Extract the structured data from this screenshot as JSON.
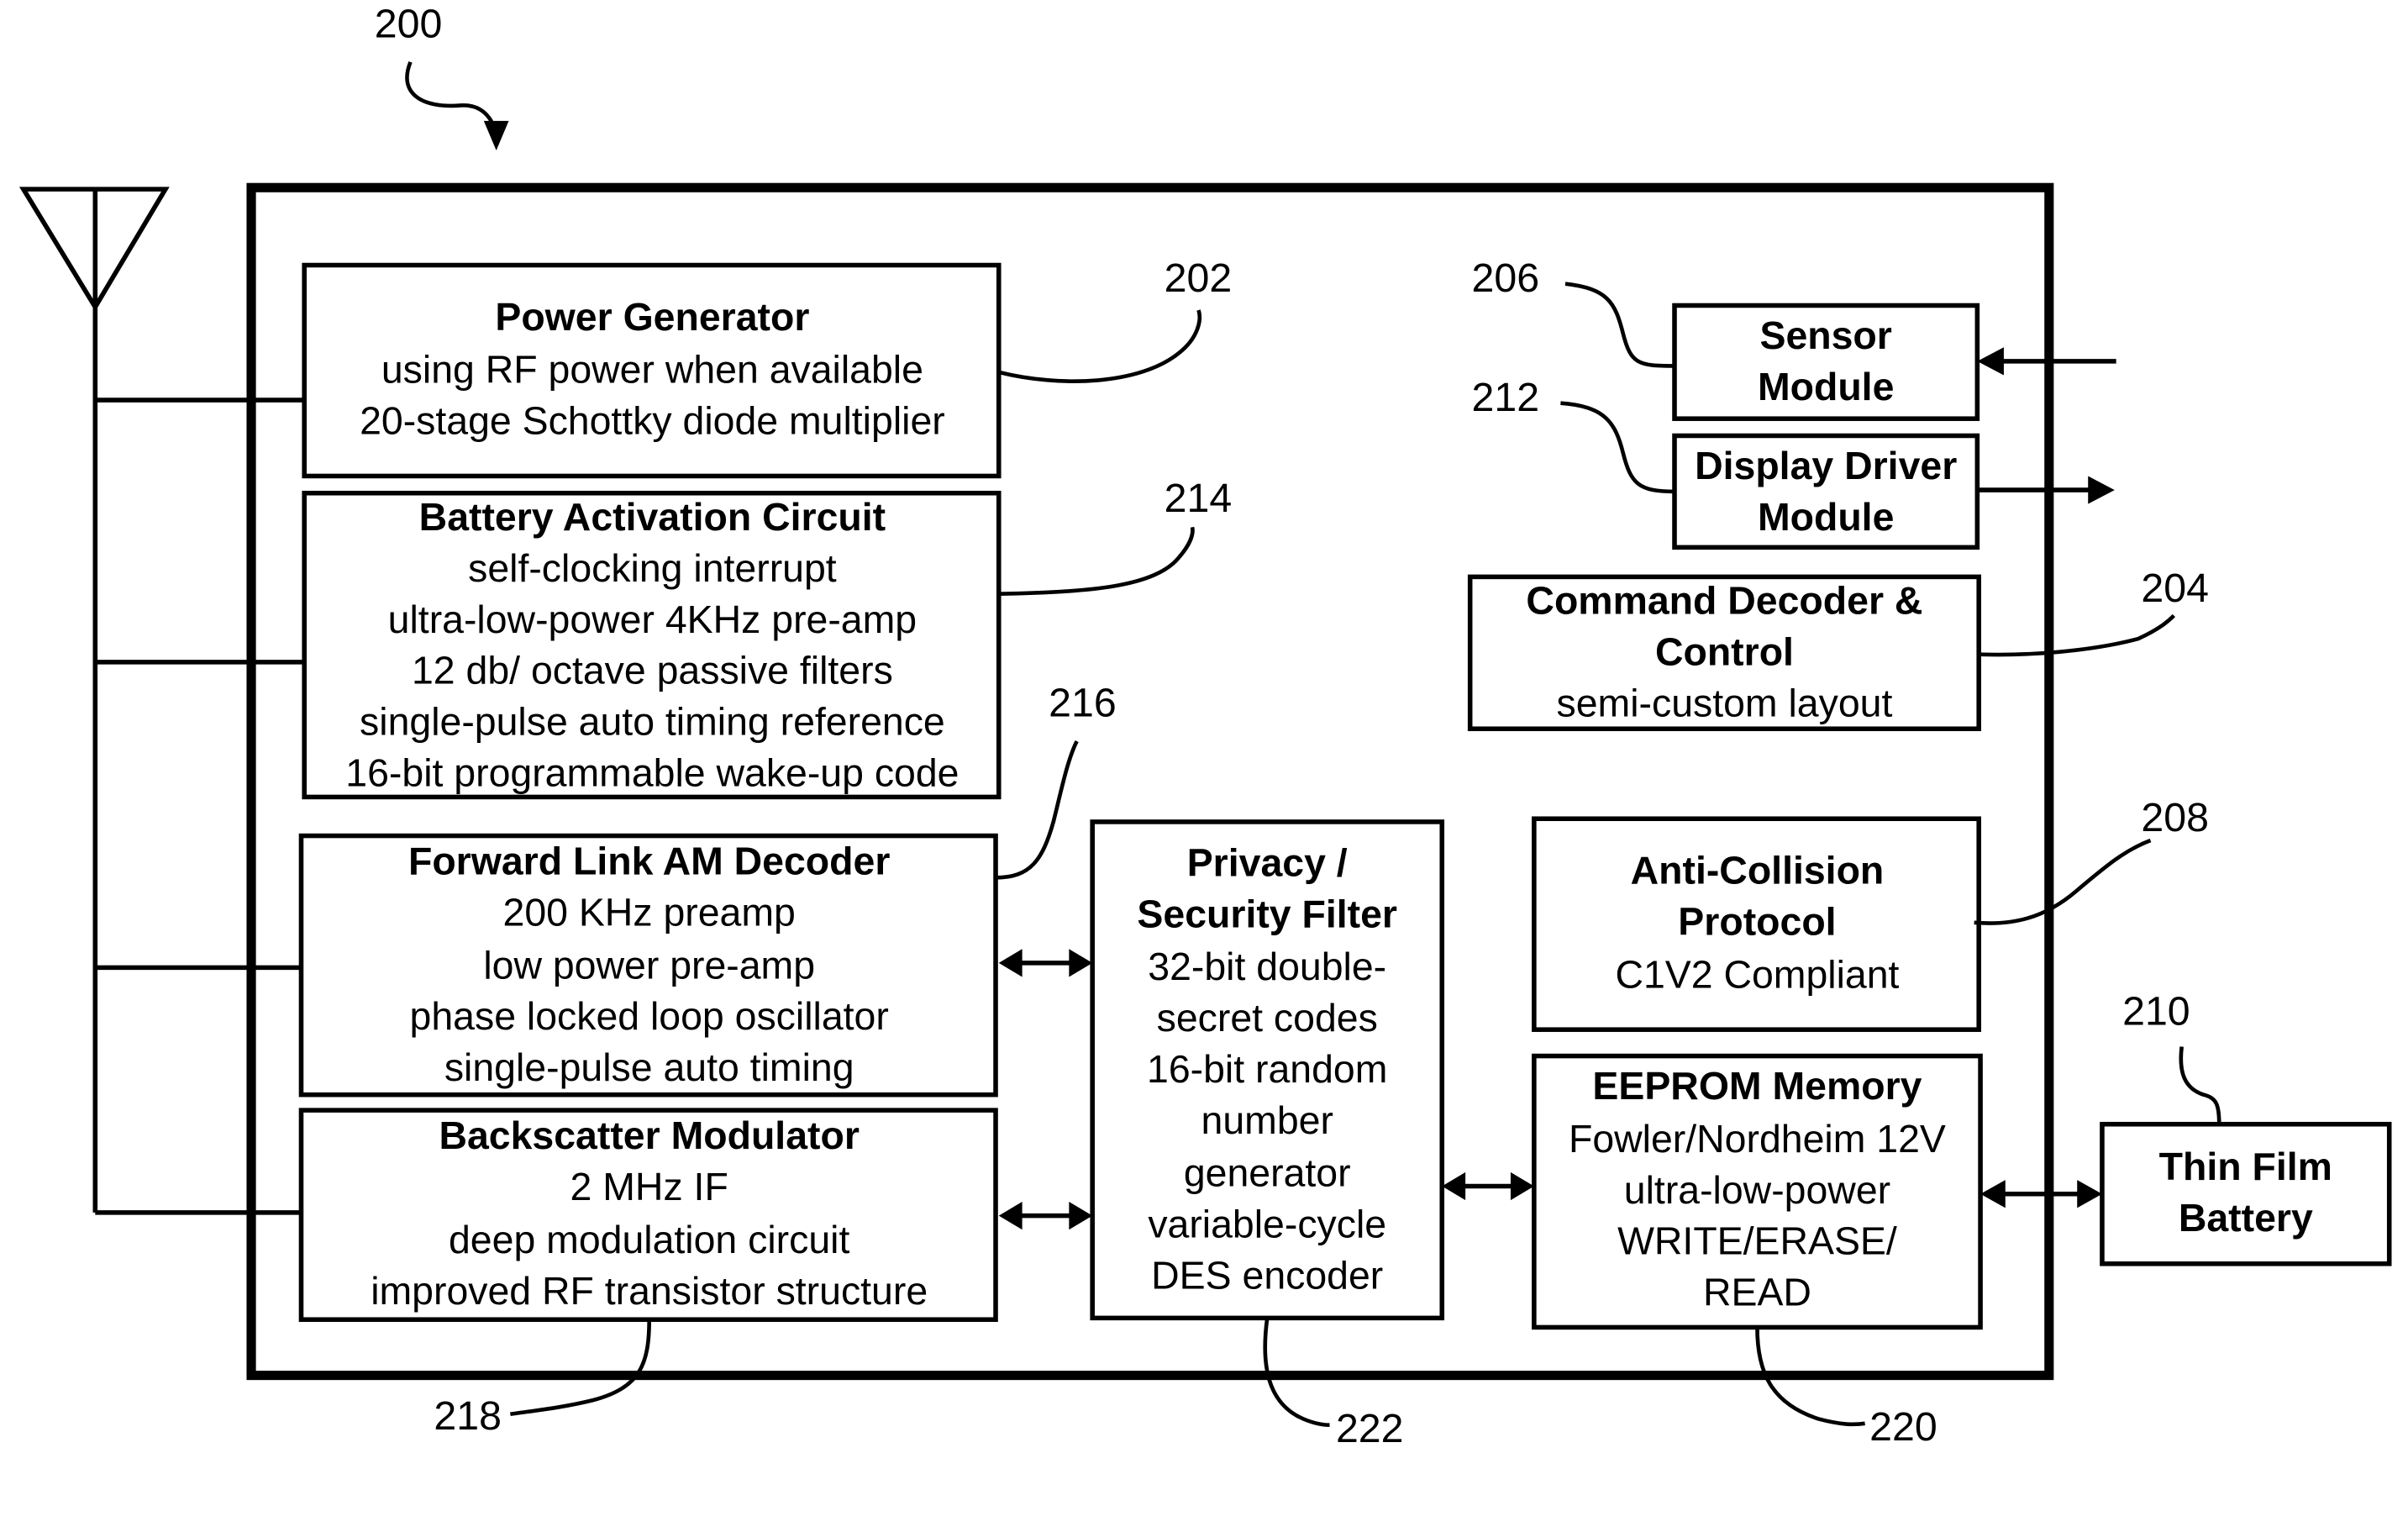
{
  "figure": {
    "ref": "200"
  },
  "antenna": {
    "icon": "antenna-icon"
  },
  "blocks": [
    {
      "id": "power-generator",
      "ref": "202",
      "title": [
        "Power Generator"
      ],
      "lines": [
        "using RF power when available",
        "20-stage Schottky diode multiplier"
      ]
    },
    {
      "id": "battery-activation",
      "ref": "214",
      "title": [
        "Battery Activation Circuit"
      ],
      "lines": [
        "self-clocking interrupt",
        "ultra-low-power 4KHz pre-amp",
        "12 db/ octave passive filters",
        "single-pulse auto timing reference",
        "16-bit programmable wake-up code"
      ]
    },
    {
      "id": "forward-link",
      "ref": "216",
      "title": [
        "Forward Link AM Decoder"
      ],
      "lines": [
        "200 KHz preamp",
        "low power pre-amp",
        "phase locked loop oscillator",
        "single-pulse auto timing"
      ]
    },
    {
      "id": "backscatter",
      "ref": "218",
      "title": [
        "Backscatter Modulator"
      ],
      "lines": [
        "2 MHz IF",
        "deep modulation circuit",
        "improved RF transistor structure"
      ]
    },
    {
      "id": "privacy-filter",
      "ref": "222",
      "title": [
        "Privacy /",
        "Security Filter"
      ],
      "lines": [
        "32-bit double-",
        "secret codes",
        "16-bit random",
        "number",
        "generator",
        "variable-cycle",
        "DES encoder"
      ]
    },
    {
      "id": "sensor-module",
      "ref": "206",
      "title": [
        "Sensor",
        "Module"
      ],
      "lines": []
    },
    {
      "id": "display-driver",
      "ref": "212",
      "title": [
        "Display Driver",
        "Module"
      ],
      "lines": []
    },
    {
      "id": "command-decoder",
      "ref": "204",
      "title": [
        "Command Decoder &",
        "Control"
      ],
      "lines": [
        "semi-custom layout"
      ]
    },
    {
      "id": "anti-collision",
      "ref": "208",
      "title": [
        "Anti-Collision",
        "Protocol"
      ],
      "lines": [
        "C1V2 Compliant"
      ]
    },
    {
      "id": "eeprom",
      "ref": "220",
      "title": [
        "EEPROM Memory"
      ],
      "lines": [
        "Fowler/Nordheim 12V",
        "ultra-low-power",
        "WRITE/ERASE/",
        "READ"
      ]
    },
    {
      "id": "thin-film-battery",
      "ref": "210",
      "title": [
        "Thin Film",
        "Battery"
      ],
      "lines": []
    }
  ]
}
